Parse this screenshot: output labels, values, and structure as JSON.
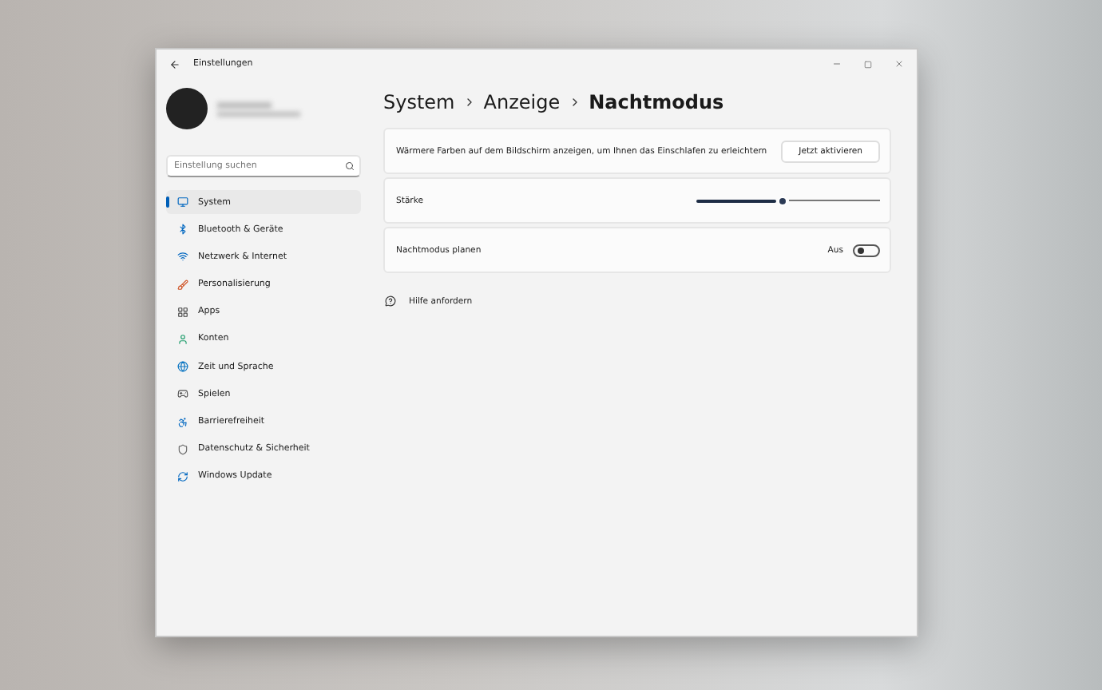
{
  "window": {
    "title": "Einstellungen"
  },
  "sidebar": {
    "search": {
      "placeholder": "Einstellung suchen"
    },
    "items": [
      {
        "label": "System",
        "selected": true
      },
      {
        "label": "Bluetooth & Geräte",
        "selected": false
      },
      {
        "label": "Netzwerk & Internet",
        "selected": false
      },
      {
        "label": "Personalisierung",
        "selected": false
      },
      {
        "label": "Apps",
        "selected": false
      },
      {
        "label": "Konten",
        "selected": false
      },
      {
        "label": "Zeit und Sprache",
        "selected": false
      },
      {
        "label": "Spielen",
        "selected": false
      },
      {
        "label": "Barrierefreiheit",
        "selected": false
      },
      {
        "label": "Datenschutz & Sicherheit",
        "selected": false
      },
      {
        "label": "Windows Update",
        "selected": false
      }
    ]
  },
  "breadcrumb": [
    "System",
    "Anzeige",
    "Nachtmodus"
  ],
  "settings": [
    {
      "kind": "button",
      "label": "Wärmere Farben auf dem Bildschirm anzeigen, um Ihnen das Einschlafen zu erleichtern",
      "button": "Jetzt aktivieren"
    },
    {
      "kind": "slider",
      "label": "Stärke",
      "level": 0.47
    },
    {
      "kind": "toggle",
      "label": "Nachtmodus planen",
      "state_label": "Aus",
      "on": false
    }
  ],
  "help_link": "Hilfe anfordern"
}
